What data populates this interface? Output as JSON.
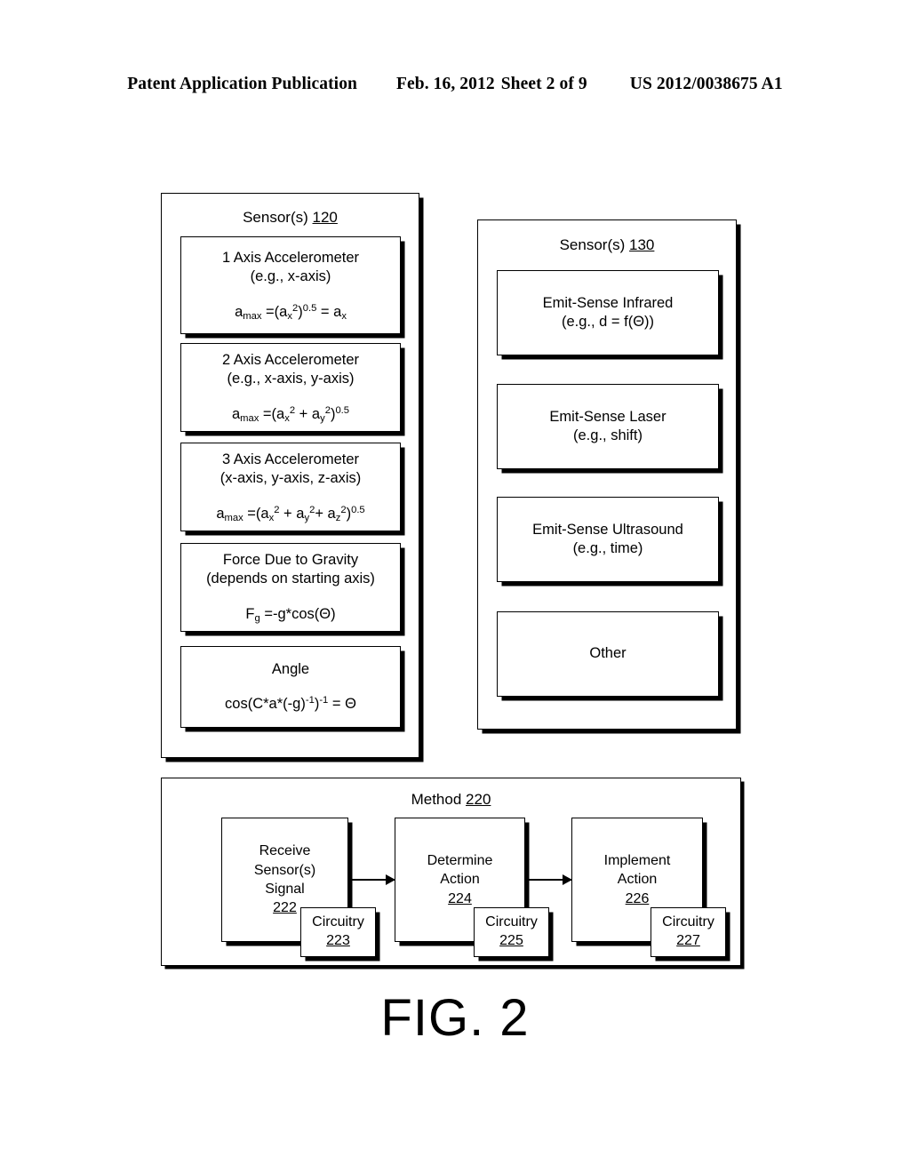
{
  "header": {
    "publication": "Patent Application Publication",
    "date": "Feb. 16, 2012",
    "sheet": "Sheet 2 of 9",
    "patent_number": "US 2012/0038675 A1"
  },
  "figure": {
    "caption": "FIG. 2"
  },
  "sensors_120": {
    "title_text": "Sensor(s) ",
    "title_ref": "120",
    "cards": [
      {
        "title": "1 Axis Accelerometer",
        "subtitle": "(e.g., x-axis)",
        "formula": "a_max =(a_x^2)^0.5 = a_x"
      },
      {
        "title": "2 Axis Accelerometer",
        "subtitle": "(e.g., x-axis, y-axis)",
        "formula": "a_max =(a_x^2 + a_y^2)^0.5"
      },
      {
        "title": "3 Axis Accelerometer",
        "subtitle": "(x-axis, y-axis, z-axis)",
        "formula": "a_max =(a_x^2 + a_y^2+ a_z^2)^0.5"
      },
      {
        "title": "Force Due to Gravity",
        "subtitle": "(depends on starting axis)",
        "formula": "F_g =-g*cos(Θ)"
      },
      {
        "title": "Angle",
        "subtitle": "",
        "formula": "cos(C*a*(-g)^-1)^-1 = Θ"
      }
    ]
  },
  "sensors_130": {
    "title_text": "Sensor(s) ",
    "title_ref": "130",
    "cards": [
      {
        "title": "Emit-Sense Infrared",
        "subtitle": "(e.g., d = f(Θ))"
      },
      {
        "title": "Emit-Sense Laser",
        "subtitle": "(e.g., shift)"
      },
      {
        "title": "Emit-Sense Ultrasound",
        "subtitle": "(e.g., time)"
      },
      {
        "title": "Other",
        "subtitle": ""
      }
    ]
  },
  "method_220": {
    "title_text": "Method ",
    "title_ref": "220",
    "steps": [
      {
        "line1": "Receive",
        "line2": "Sensor(s)",
        "line3": "Signal",
        "ref": "222",
        "circuitry_label": "Circuitry",
        "circuitry_ref": "223"
      },
      {
        "line1": "Determine",
        "line2": "Action",
        "line3": "",
        "ref": "224",
        "circuitry_label": "Circuitry",
        "circuitry_ref": "225"
      },
      {
        "line1": "Implement",
        "line2": "Action",
        "line3": "",
        "ref": "226",
        "circuitry_label": "Circuitry",
        "circuitry_ref": "227"
      }
    ]
  }
}
